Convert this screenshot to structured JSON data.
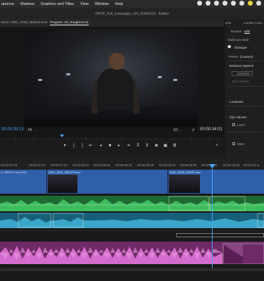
{
  "menubar": {
    "items": [
      "quence",
      "Markers",
      "Graphics and Titles",
      "View",
      "Window",
      "Help"
    ]
  },
  "window": {
    "title": "DRYP_Fall_Campaign_v24_20240110 - Edited"
  },
  "tabs": {
    "source": "ource: A001_A015_0825CP.mov",
    "program": "Program: Ad_RoughCut v1",
    "program_menu": "≡"
  },
  "monitor": {
    "timecode_left": "00:00:09:13",
    "fit": "Fit",
    "fraction": "1/1",
    "timecode_right": "00:00:34:01"
  },
  "right_panel": {
    "tab_effects": "ects",
    "tab_lumetri": "Lumetri Color",
    "tab_browse": "Browse",
    "tab_edit": "Edit",
    "multicam": "Multicam Attrib",
    "dialogue": "Dialogue",
    "preset_label": "Preset:",
    "preset_value": "(Custom)",
    "enhance_speech": "Enhance Speech",
    "enhance_btn": "Enhance",
    "mix_amount": "Mix Amount",
    "loudness": "Loudness",
    "clip_volume": "Clip Volume",
    "level": "Level",
    "mute": "Mute"
  },
  "timeline": {
    "ticks": [
      "00:00:07:08",
      "00:00:07:12",
      "00:00:07:18",
      "00:00:08:03",
      "00:00:08:08",
      "00:00:08:13",
      "00:00:08:18",
      "00:00:09:03",
      "00:00:09:08",
      "00:00:09:11",
      "00:00:10:08",
      "00:00:10:11"
    ],
    "clips": [
      {
        "label": "0_0825CP.mov [5%]"
      },
      {
        "label": "A001_A011_0825CP.mov"
      },
      {
        "label": "A002_A008_0825FI.mov"
      }
    ]
  },
  "colors": {
    "accent": "#4aa3ff",
    "video_clip": "#2e5fa8",
    "audio_green": "#2f9e4a",
    "audio_blue": "#2a8aa8",
    "audio_pink": "#b04aa8"
  }
}
